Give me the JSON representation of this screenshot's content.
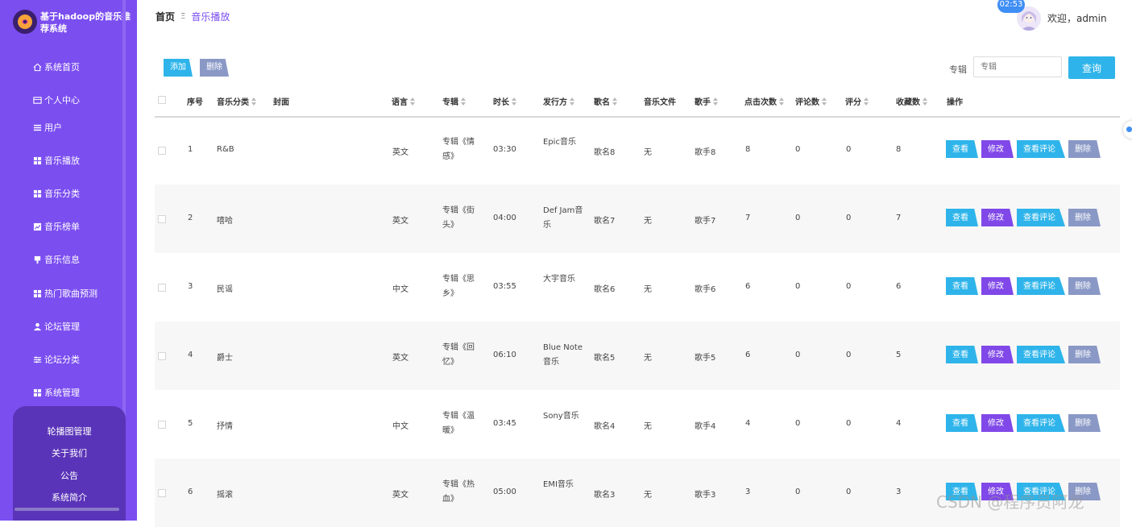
{
  "app": {
    "title": "基于hadoop的音乐推荐系统"
  },
  "sidebar": {
    "items": [
      {
        "label": "系统首页",
        "icon": "home-icon"
      },
      {
        "label": "个人中心",
        "icon": "id-card-icon"
      },
      {
        "label": "用户",
        "icon": "list-icon"
      },
      {
        "label": "音乐播放",
        "icon": "grid-icon"
      },
      {
        "label": "音乐分类",
        "icon": "grid-icon"
      },
      {
        "label": "音乐榜单",
        "icon": "chart-icon"
      },
      {
        "label": "音乐信息",
        "icon": "pin-icon"
      },
      {
        "label": "热门歌曲预测",
        "icon": "grid-icon"
      },
      {
        "label": "论坛管理",
        "icon": "user-icon"
      },
      {
        "label": "论坛分类",
        "icon": "sliders-icon"
      },
      {
        "label": "系统管理",
        "icon": "grid-icon"
      }
    ],
    "submenu": [
      "轮播图管理",
      "关于我们",
      "公告",
      "系统简介"
    ]
  },
  "header": {
    "breadcrumb_home": "首页",
    "breadcrumb_sep": "Ξ",
    "breadcrumb_current": "音乐播放",
    "welcome": "欢迎，admin",
    "time": "02:53"
  },
  "toolbar": {
    "add_label": "添加",
    "delete_label": "删除",
    "search_label": "专辑",
    "search_placeholder": "专辑",
    "search_button": "查询"
  },
  "table": {
    "headers": [
      "序号",
      "音乐分类",
      "封面",
      "语言",
      "专辑",
      "时长",
      "发行方",
      "歌名",
      "音乐文件",
      "歌手",
      "点击次数",
      "评论数",
      "评分",
      "收藏数",
      "操作"
    ],
    "rows": [
      {
        "no": "1",
        "category": "R&B",
        "language": "英文",
        "album": "专辑《情感》",
        "duration": "03:30",
        "publisher": "Epic音乐",
        "song": "歌名8",
        "file": "无",
        "singer": "歌手8",
        "clicks": "8",
        "comments": "0",
        "rating": "0",
        "favorites": "8"
      },
      {
        "no": "2",
        "category": "嘻哈",
        "language": "英文",
        "album": "专辑《街头》",
        "duration": "04:00",
        "publisher": "Def Jam音乐",
        "song": "歌名7",
        "file": "无",
        "singer": "歌手7",
        "clicks": "7",
        "comments": "0",
        "rating": "0",
        "favorites": "7"
      },
      {
        "no": "3",
        "category": "民谣",
        "language": "中文",
        "album": "专辑《思乡》",
        "duration": "03:55",
        "publisher": "大宇音乐",
        "song": "歌名6",
        "file": "无",
        "singer": "歌手6",
        "clicks": "6",
        "comments": "0",
        "rating": "0",
        "favorites": "6"
      },
      {
        "no": "4",
        "category": "爵士",
        "language": "英文",
        "album": "专辑《回忆》",
        "duration": "06:10",
        "publisher": "Blue Note音乐",
        "song": "歌名5",
        "file": "无",
        "singer": "歌手5",
        "clicks": "6",
        "comments": "0",
        "rating": "0",
        "favorites": "5"
      },
      {
        "no": "5",
        "category": "抒情",
        "language": "中文",
        "album": "专辑《温暖》",
        "duration": "03:45",
        "publisher": "Sony音乐",
        "song": "歌名4",
        "file": "无",
        "singer": "歌手4",
        "clicks": "4",
        "comments": "0",
        "rating": "0",
        "favorites": "4"
      },
      {
        "no": "6",
        "category": "摇滚",
        "language": "英文",
        "album": "专辑《热血》",
        "duration": "05:00",
        "publisher": "EMI音乐",
        "song": "歌名3",
        "file": "无",
        "singer": "歌手3",
        "clicks": "3",
        "comments": "0",
        "rating": "0",
        "favorites": "3"
      }
    ],
    "actions": {
      "view": "查看",
      "edit": "修改",
      "comments": "查看评论",
      "delete": "删除"
    }
  },
  "watermark": "CSDN @程序员阿龙",
  "colors": {
    "sidebar": "#7b4ef0",
    "accent": "#2eb4ea",
    "edit": "#8048e8",
    "delete": "#8a98c6"
  }
}
